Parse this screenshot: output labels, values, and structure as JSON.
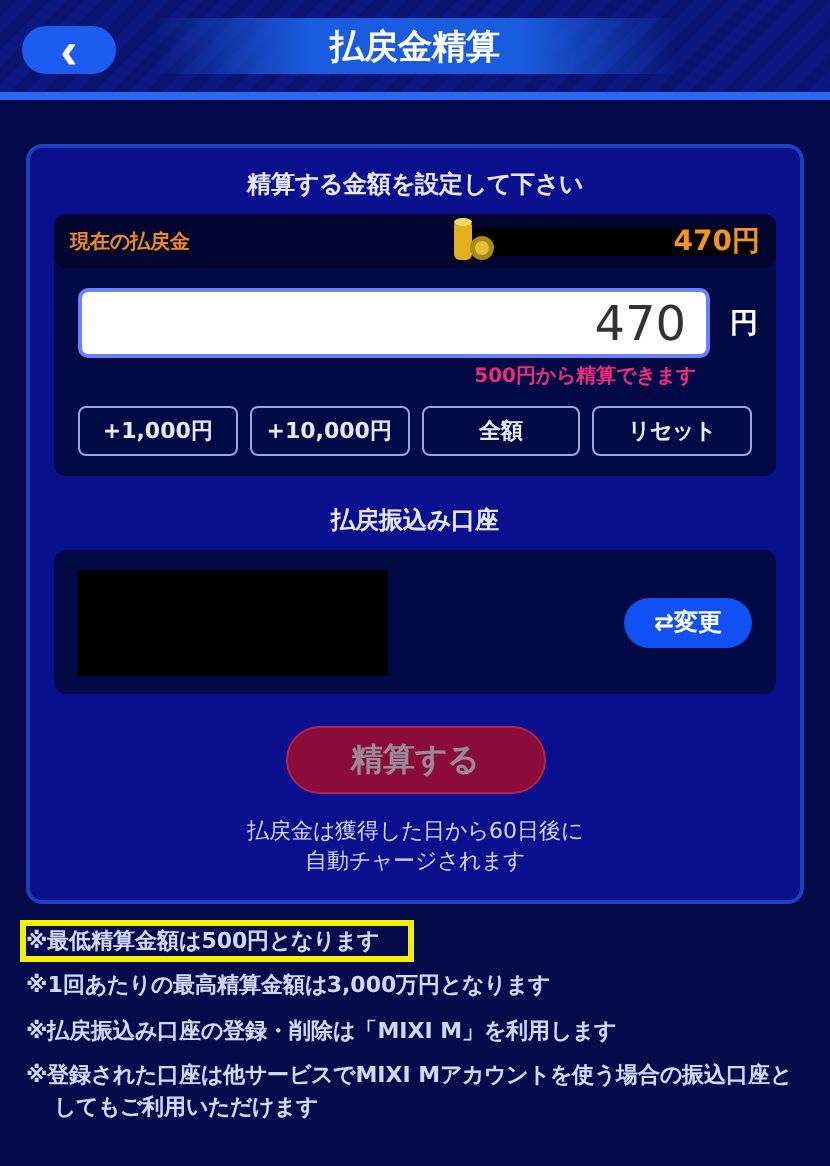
{
  "header": {
    "back_label": "‹",
    "title": "払戻金精算"
  },
  "amount_section": {
    "heading": "精算する金額を設定して下さい",
    "balance": {
      "label": "現在の払戻金",
      "value": "470円"
    },
    "input": {
      "value": "470",
      "unit": "円",
      "error": "500円から精算できます"
    },
    "quick_buttons": [
      "+1,000円",
      "+10,000円",
      "全額",
      "リセット"
    ]
  },
  "account_section": {
    "heading": "払戻振込み口座",
    "account_redacted": true,
    "change_button": {
      "icon": "⇄",
      "label": "変更"
    }
  },
  "submit": {
    "label": "精算する",
    "disabled": true
  },
  "auto_charge_note": [
    "払戻金は獲得した日から60日後に",
    "自動チャージされます"
  ],
  "notes": [
    {
      "text": "※最低精算金額は500円となります",
      "highlighted": true
    },
    {
      "text": "※1回あたりの最高精算金額は3,000万円となります",
      "highlighted": false
    },
    {
      "text": "※払戻振込み口座の登録・削除は「MIXI M」を利用します",
      "highlighted": false
    },
    {
      "text": "※登録された口座は他サービスでMIXI Mアカウントを使う場合の振込口座としてもご利用いただけます",
      "highlighted": false
    }
  ]
}
